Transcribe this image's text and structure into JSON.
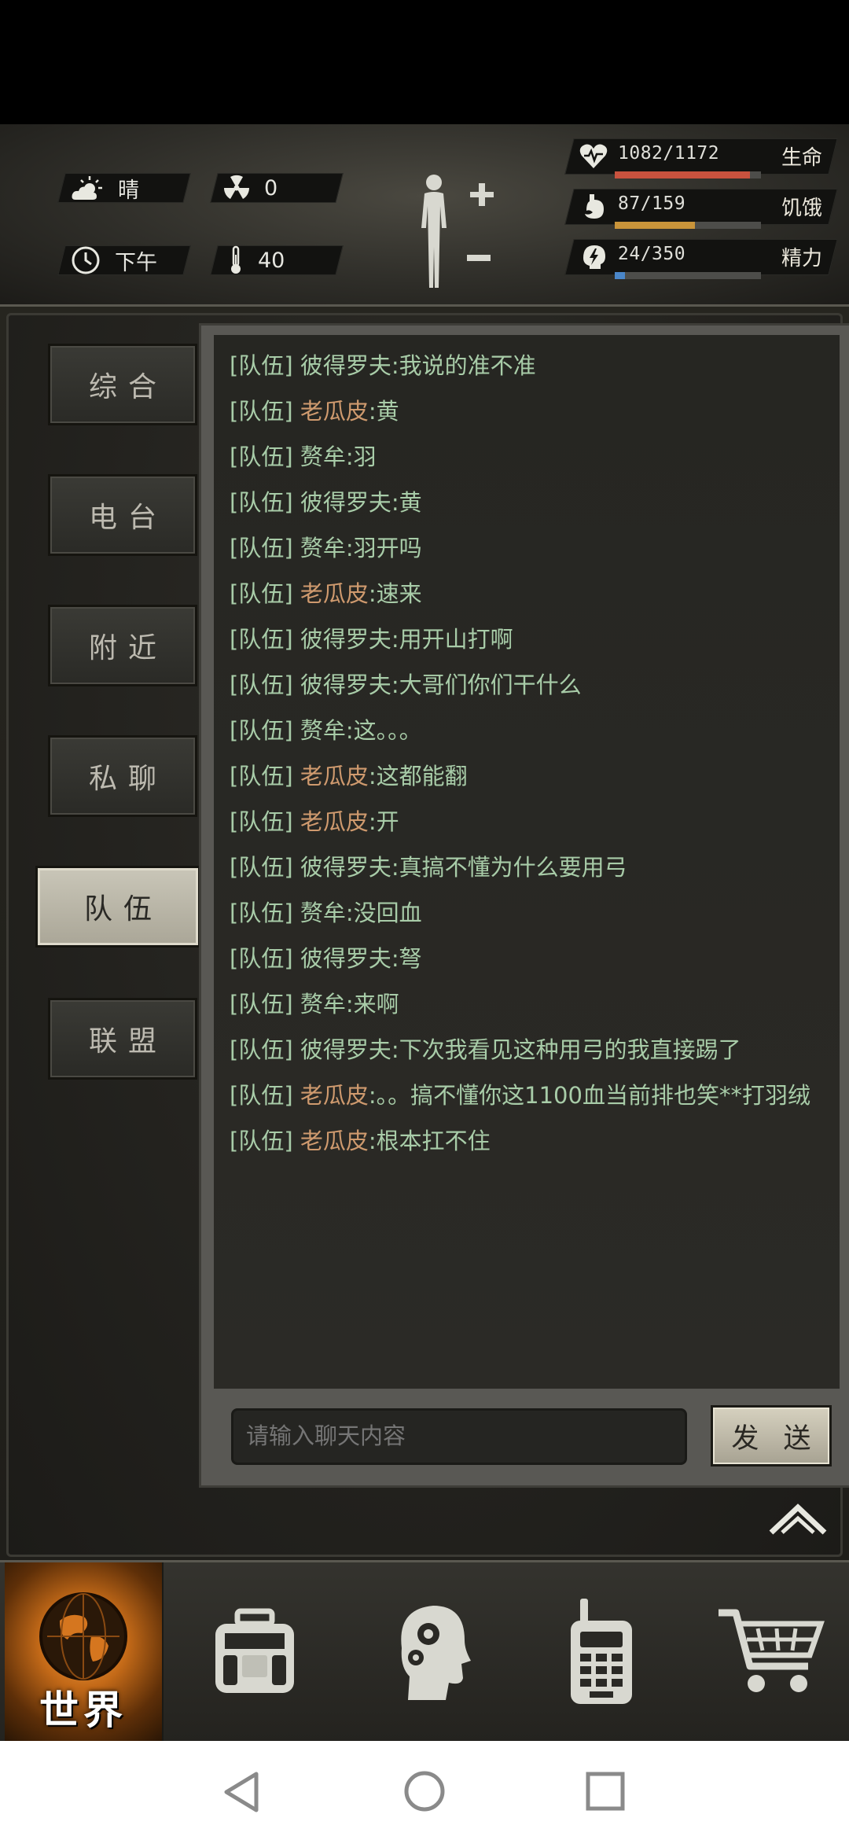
{
  "hud": {
    "weather": "晴",
    "radiation": "0",
    "time_of_day": "下午",
    "temperature": "40",
    "stats": [
      {
        "icon": "heart-icon",
        "value": "1082/1172",
        "label": "生命",
        "color": "#c8523e",
        "fraction": 0.923
      },
      {
        "icon": "stomach-icon",
        "value": "87/159",
        "label": "饥饿",
        "color": "#c9943a",
        "fraction": 0.547
      },
      {
        "icon": "energy-icon",
        "value": "24/350",
        "label": "精力",
        "color": "#4a86c8",
        "fraction": 0.069
      }
    ]
  },
  "tabs": [
    "综合",
    "电台",
    "附近",
    "私聊",
    "队伍",
    "联盟"
  ],
  "active_tab": "队伍",
  "messages": [
    {
      "channel": "[队伍]",
      "name": "彼得罗夫",
      "name_color": "green",
      "text": ":我说的准不准"
    },
    {
      "channel": "[队伍]",
      "name": "老瓜皮",
      "name_color": "orange",
      "text": ":黄"
    },
    {
      "channel": "[队伍]",
      "name": "赘牟",
      "name_color": "green",
      "text": ":羽"
    },
    {
      "channel": "[队伍]",
      "name": "彼得罗夫",
      "name_color": "green",
      "text": ":黄"
    },
    {
      "channel": "[队伍]",
      "name": "赘牟",
      "name_color": "green",
      "text": ":羽开吗"
    },
    {
      "channel": "[队伍]",
      "name": "老瓜皮",
      "name_color": "orange",
      "text": ":速来"
    },
    {
      "channel": "[队伍]",
      "name": "彼得罗夫",
      "name_color": "green",
      "text": ":用开山打啊"
    },
    {
      "channel": "[队伍]",
      "name": "彼得罗夫",
      "name_color": "green",
      "text": ":大哥们你们干什么"
    },
    {
      "channel": "[队伍]",
      "name": "赘牟",
      "name_color": "green",
      "text": ":这。。。"
    },
    {
      "channel": "[队伍]",
      "name": "老瓜皮",
      "name_color": "orange",
      "text": ":这都能翻"
    },
    {
      "channel": "[队伍]",
      "name": "老瓜皮",
      "name_color": "orange",
      "text": ":开"
    },
    {
      "channel": "[队伍]",
      "name": "彼得罗夫",
      "name_color": "green",
      "text": ":真搞不懂为什么要用弓"
    },
    {
      "channel": "[队伍]",
      "name": "赘牟",
      "name_color": "green",
      "text": ":没回血"
    },
    {
      "channel": "[队伍]",
      "name": "彼得罗夫",
      "name_color": "green",
      "text": ":弩"
    },
    {
      "channel": "[队伍]",
      "name": "赘牟",
      "name_color": "green",
      "text": ":来啊"
    },
    {
      "channel": "[队伍]",
      "name": "彼得罗夫",
      "name_color": "green",
      "text": ":下次我看见这种用弓的我直接踢了"
    },
    {
      "channel": "[队伍]",
      "name": "老瓜皮",
      "name_color": "orange",
      "text": ":。。搞不懂你这1100血当前排也笑**打羽绒"
    },
    {
      "channel": "[队伍]",
      "name": "老瓜皮",
      "name_color": "orange",
      "text": ":根本扛不住"
    }
  ],
  "input": {
    "placeholder": "请输入聊天内容"
  },
  "send_label": "发 送",
  "nav": {
    "world_label": "世界",
    "items": [
      "backpack-icon",
      "skills-head-icon",
      "radio-phone-icon",
      "shop-cart-icon"
    ]
  }
}
